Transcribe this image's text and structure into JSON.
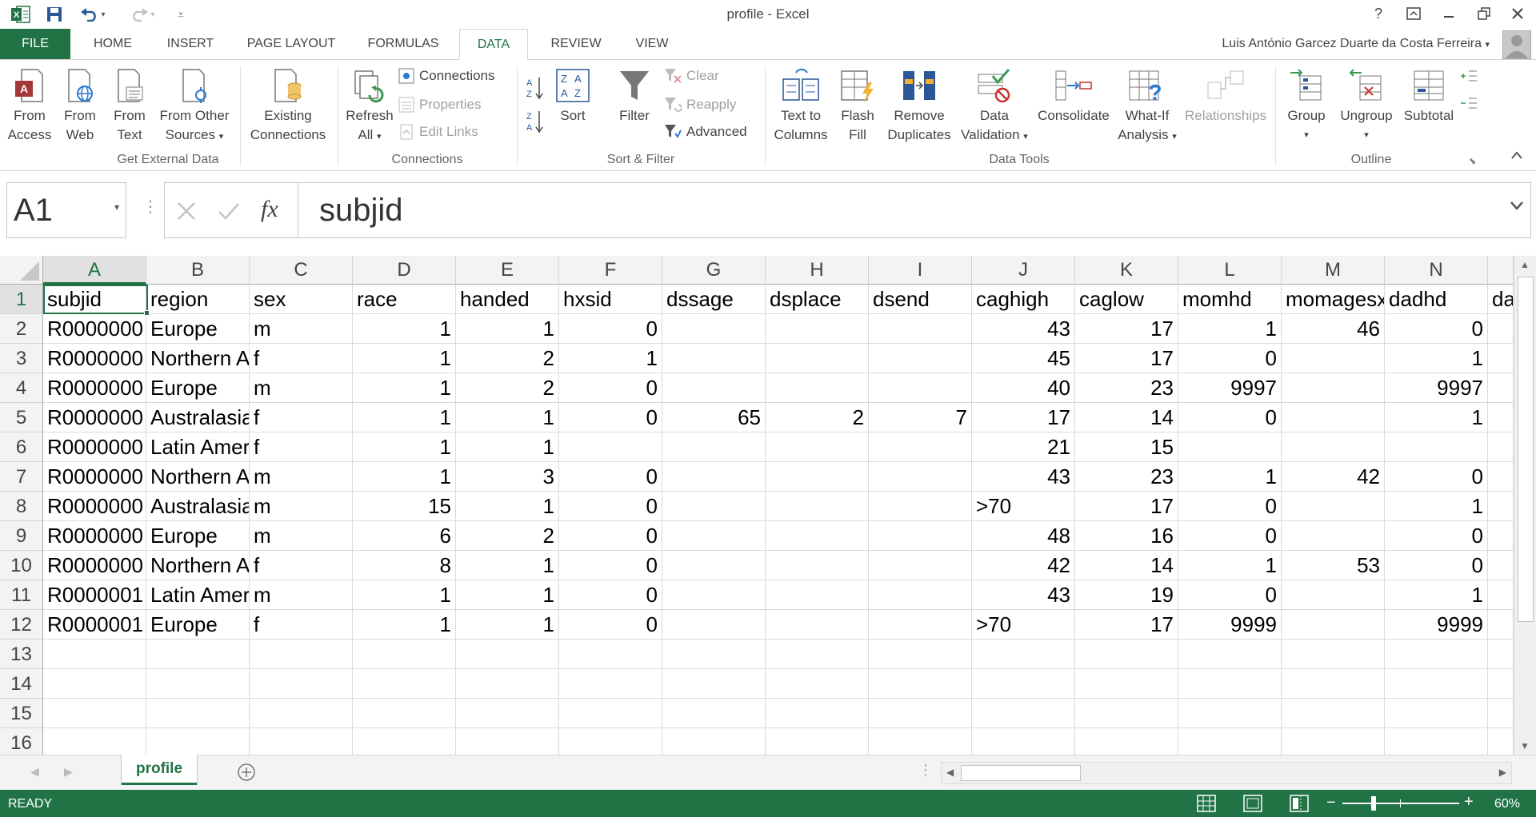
{
  "window": {
    "title": "profile - Excel",
    "help": "?",
    "user": "Luis António Garcez Duarte da Costa Ferreira"
  },
  "tabs": [
    {
      "label": "FILE"
    },
    {
      "label": "HOME"
    },
    {
      "label": "INSERT"
    },
    {
      "label": "PAGE LAYOUT"
    },
    {
      "label": "FORMULAS"
    },
    {
      "label": "DATA"
    },
    {
      "label": "REVIEW"
    },
    {
      "label": "VIEW"
    }
  ],
  "ribbon": {
    "get_external_data": {
      "label": "Get External Data",
      "from_access": [
        "From",
        "Access"
      ],
      "from_web": [
        "From",
        "Web"
      ],
      "from_text": [
        "From",
        "Text"
      ],
      "from_other": [
        "From Other",
        "Sources"
      ],
      "existing": [
        "Existing",
        "Connections"
      ]
    },
    "connections": {
      "label": "Connections",
      "refresh": [
        "Refresh",
        "All"
      ],
      "connections": "Connections",
      "properties": "Properties",
      "edit_links": "Edit Links"
    },
    "sort_filter": {
      "label": "Sort & Filter",
      "sort": "Sort",
      "filter": "Filter",
      "clear": "Clear",
      "reapply": "Reapply",
      "advanced": "Advanced"
    },
    "data_tools": {
      "label": "Data Tools",
      "text_to_columns": [
        "Text to",
        "Columns"
      ],
      "flash_fill": [
        "Flash",
        "Fill"
      ],
      "remove_duplicates": [
        "Remove",
        "Duplicates"
      ],
      "data_validation": [
        "Data",
        "Validation"
      ],
      "consolidate": "Consolidate",
      "what_if": [
        "What-If",
        "Analysis"
      ],
      "relationships": "Relationships"
    },
    "outline": {
      "label": "Outline",
      "group": "Group",
      "ungroup": "Ungroup",
      "subtotal": "Subtotal"
    }
  },
  "formula_bar": {
    "name_box": "A1",
    "fx": "fx",
    "formula": "subjid"
  },
  "grid": {
    "columns": [
      "A",
      "B",
      "C",
      "D",
      "E",
      "F",
      "G",
      "H",
      "I",
      "J",
      "K",
      "L",
      "M",
      "N"
    ],
    "rows": [
      "1",
      "2",
      "3",
      "4",
      "5",
      "6",
      "7",
      "8",
      "9",
      "10",
      "11",
      "12",
      "13",
      "14",
      "15",
      "16"
    ],
    "cells": [
      [
        "subjid",
        "region",
        "sex",
        "race",
        "handed",
        "hxsid",
        "dssage",
        "dsplace",
        "dsend",
        "caghigh",
        "caglow",
        "momhd",
        "momagesx",
        "dadhd",
        "da"
      ],
      [
        "R0000000",
        "Europe",
        "m",
        "1",
        "1",
        "0",
        "",
        "",
        "",
        "43",
        "17",
        "1",
        "46",
        "0",
        ""
      ],
      [
        "R0000000",
        "Northern A",
        "f",
        "1",
        "2",
        "1",
        "",
        "",
        "",
        "45",
        "17",
        "0",
        "",
        "1",
        ""
      ],
      [
        "R0000000",
        "Europe",
        "m",
        "1",
        "2",
        "0",
        "",
        "",
        "",
        "40",
        "23",
        "9997",
        "",
        "9997",
        ""
      ],
      [
        "R0000000",
        "Australasia",
        "f",
        "1",
        "1",
        "0",
        "65",
        "2",
        "7",
        "17",
        "14",
        "0",
        "",
        "1",
        ""
      ],
      [
        "R0000000",
        "Latin Amer",
        "f",
        "1",
        "1",
        "",
        "",
        "",
        "",
        "21",
        "15",
        "",
        "",
        "",
        ""
      ],
      [
        "R0000000",
        "Northern A",
        "m",
        "1",
        "3",
        "0",
        "",
        "",
        "",
        "43",
        "23",
        "1",
        "42",
        "0",
        ""
      ],
      [
        "R0000000",
        "Australasia",
        "m",
        "15",
        "1",
        "0",
        "",
        "",
        "",
        ">70",
        "17",
        "0",
        "",
        "1",
        ""
      ],
      [
        "R0000000",
        "Europe",
        "m",
        "6",
        "2",
        "0",
        "",
        "",
        "",
        "48",
        "16",
        "0",
        "",
        "0",
        ""
      ],
      [
        "R0000000",
        "Northern A",
        "f",
        "8",
        "1",
        "0",
        "",
        "",
        "",
        "42",
        "14",
        "1",
        "53",
        "0",
        ""
      ],
      [
        "R0000001",
        "Latin Amer",
        "m",
        "1",
        "1",
        "0",
        "",
        "",
        "",
        "43",
        "19",
        "0",
        "",
        "1",
        ""
      ],
      [
        "R0000001",
        "Europe",
        "f",
        "1",
        "1",
        "0",
        "",
        "",
        "",
        ">70",
        "17",
        "9999",
        "",
        "9999",
        ""
      ]
    ]
  },
  "sheets": [
    {
      "label": "profile"
    }
  ],
  "status": {
    "ready": "READY",
    "zoom": "60%"
  }
}
